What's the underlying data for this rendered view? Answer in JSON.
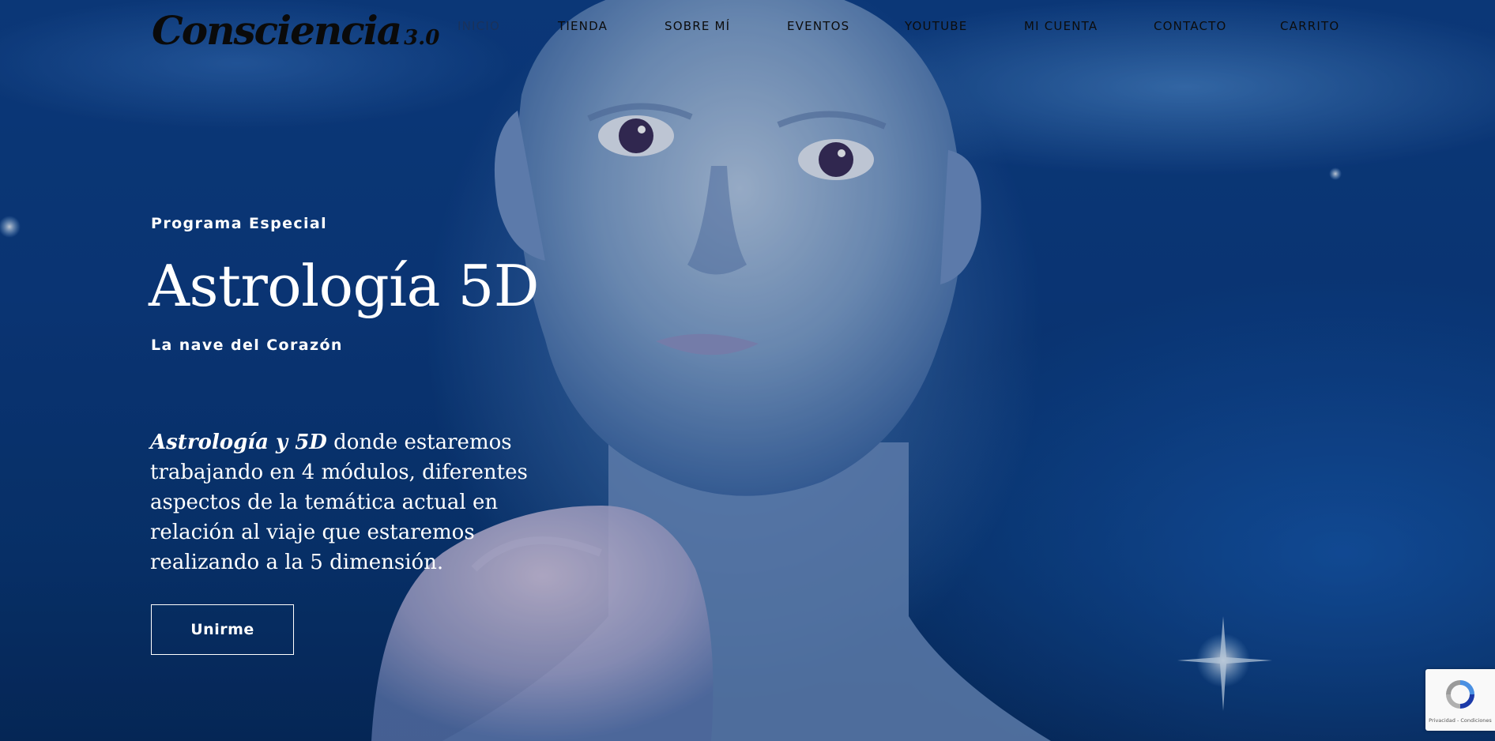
{
  "site": {
    "logo_text": "Consciencia",
    "logo_version": "3.0"
  },
  "nav": {
    "items": [
      {
        "label": "INICIO",
        "active": true
      },
      {
        "label": "TIENDA",
        "active": false
      },
      {
        "label": "SOBRE MÍ",
        "active": false
      },
      {
        "label": "EVENTOS",
        "active": false
      },
      {
        "label": "YOUTUBE",
        "active": false
      },
      {
        "label": "MI CUENTA",
        "active": false
      },
      {
        "label": "CONTACTO",
        "active": false
      },
      {
        "label": "CARRITO",
        "active": false
      }
    ]
  },
  "hero": {
    "eyebrow": "Programa Especial",
    "title": "Astrología 5D",
    "subtitle": "La nave del Corazón",
    "description_emphasis": "Astrología y 5D",
    "description_rest": " donde estaremos trabajando en 4 módulos, diferentes aspectos de la temática actual en relación al viaje que estaremos realizando a la 5 dimensión.",
    "cta_label": "Unirme"
  },
  "recaptcha": {
    "legal": "Privacidad - Condiciones",
    "icon": "recaptcha-icon"
  },
  "colors": {
    "hero_background": "#0b3b80",
    "nav_text": "#0c0c0c",
    "hero_text": "#ffffff"
  }
}
